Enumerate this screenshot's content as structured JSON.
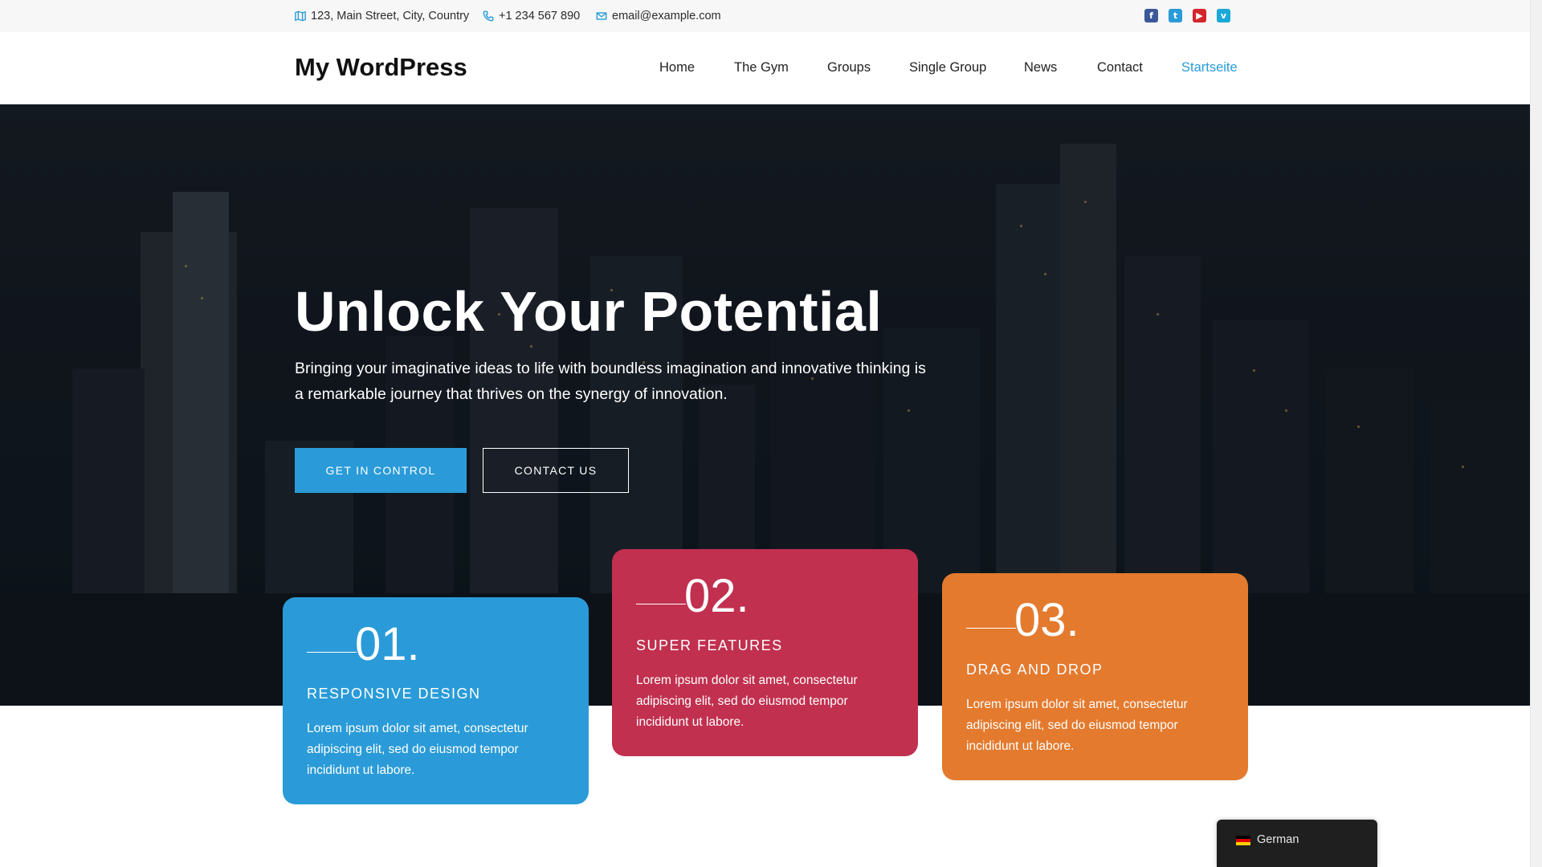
{
  "topbar": {
    "address": "123, Main Street, City, Country",
    "phone": "+1 234 567 890",
    "email": "email@example.com",
    "social_icons": [
      "facebook-icon",
      "twitter-icon",
      "youtube-icon",
      "vimeo-icon"
    ]
  },
  "header": {
    "site_title": "My WordPress",
    "nav": [
      {
        "label": "Home"
      },
      {
        "label": "The Gym"
      },
      {
        "label": "Groups"
      },
      {
        "label": "Single Group"
      },
      {
        "label": "News"
      },
      {
        "label": "Contact"
      },
      {
        "label": "Startseite",
        "active": true
      }
    ]
  },
  "hero": {
    "title": "Unlock Your Potential",
    "subtitle": "Bringing your imaginative ideas to life with boundless imagination and innovative thinking is a remarkable journey that thrives on the synergy of innovation.",
    "primary_button": "GET IN CONTROL",
    "secondary_button": "CONTACT US"
  },
  "features": [
    {
      "number": "01.",
      "title": "RESPONSIVE DESIGN",
      "text": "Lorem ipsum dolor sit amet, consectetur adipiscing elit, sed do eiusmod tempor incididunt ut labore.",
      "color": "#2a9bd8"
    },
    {
      "number": "02.",
      "title": "SUPER FEATURES",
      "text": "Lorem ipsum dolor sit amet, consectetur adipiscing elit, sed do eiusmod tempor incididunt ut labore.",
      "color": "#c1304f"
    },
    {
      "number": "03.",
      "title": "DRAG AND DROP",
      "text": "Lorem ipsum dolor sit amet, consectetur adipiscing elit, sed do eiusmod tempor incididunt ut labore.",
      "color": "#e47a2e"
    }
  ],
  "language_switcher": {
    "label": "German"
  },
  "colors": {
    "accent": "#2a9bd8",
    "card_blue": "#2a9bd8",
    "card_red": "#c1304f",
    "card_orange": "#e47a2e"
  }
}
